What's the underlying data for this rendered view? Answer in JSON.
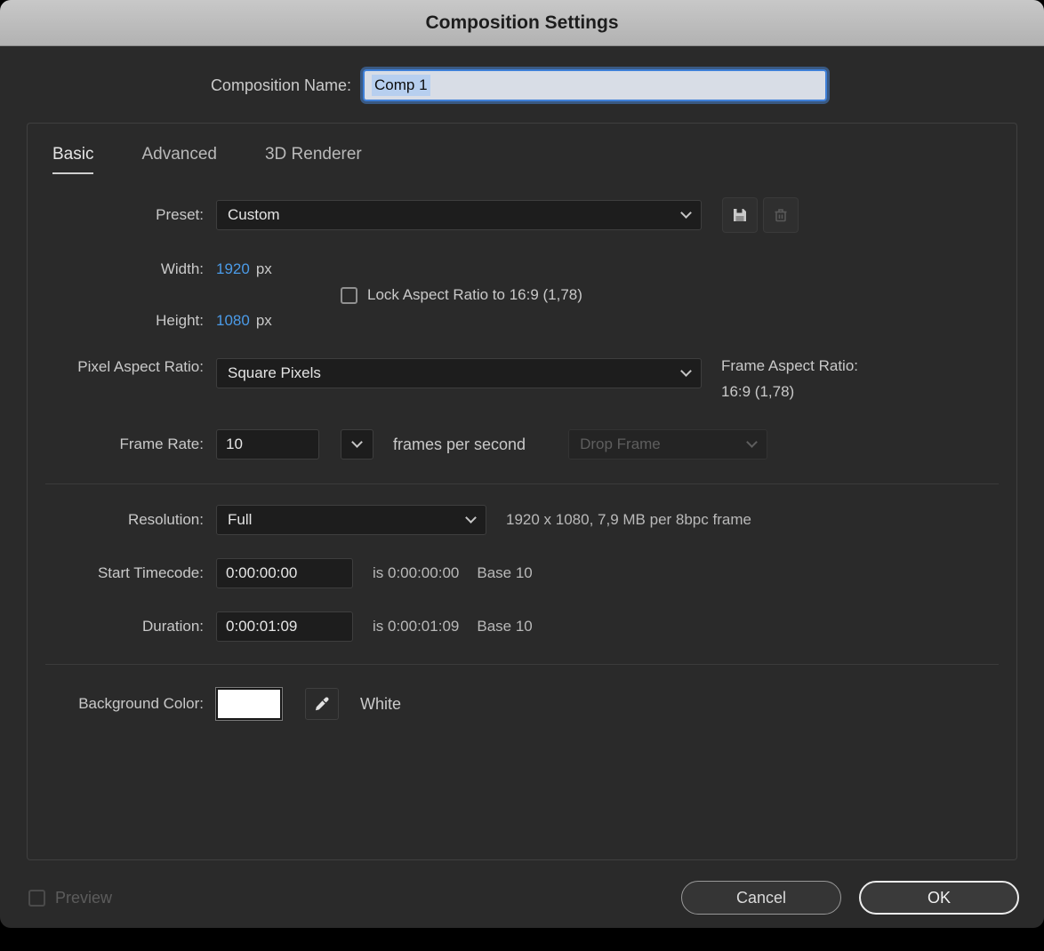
{
  "dialog": {
    "title": "Composition Settings",
    "composition_name": {
      "label": "Composition Name:",
      "value": "Comp 1"
    },
    "tabs": [
      {
        "label": "Basic"
      },
      {
        "label": "Advanced"
      },
      {
        "label": "3D Renderer"
      }
    ],
    "active_tab": "Basic",
    "preset": {
      "label": "Preset:",
      "value": "Custom"
    },
    "dimensions": {
      "width": {
        "label": "Width:",
        "value": "1920",
        "unit": "px"
      },
      "height": {
        "label": "Height:",
        "value": "1080",
        "unit": "px"
      },
      "lock_aspect": {
        "label": "Lock Aspect Ratio to 16:9 (1,78)",
        "checked": false
      }
    },
    "pixel_aspect_ratio": {
      "label": "Pixel Aspect Ratio:",
      "value": "Square Pixels"
    },
    "frame_aspect_ratio": {
      "label": "Frame Aspect Ratio:",
      "value": "16:9 (1,78)"
    },
    "frame_rate": {
      "label": "Frame Rate:",
      "value": "10",
      "suffix": "frames per second",
      "timecode_style": "Drop Frame",
      "timecode_style_enabled": false
    },
    "resolution": {
      "label": "Resolution:",
      "value": "Full",
      "info": "1920 x 1080, 7,9 MB per 8bpc frame"
    },
    "start_timecode": {
      "label": "Start Timecode:",
      "value": "0:00:00:00",
      "equivalent": "is 0:00:00:00",
      "base": "Base 10"
    },
    "duration": {
      "label": "Duration:",
      "value": "0:00:01:09",
      "equivalent": "is 0:00:01:09",
      "base": "Base 10"
    },
    "background_color": {
      "label": "Background Color:",
      "color": "#ffffff",
      "color_name": "White"
    },
    "footer": {
      "preview_label": "Preview",
      "preview_checked": false,
      "cancel_label": "Cancel",
      "ok_label": "OK"
    }
  },
  "colors": {
    "hot_text_blue": "#4b9be8",
    "selection_highlight": "#b7cfef",
    "focus_ring": "#3f80d8",
    "background_swatch": "#ffffff"
  }
}
